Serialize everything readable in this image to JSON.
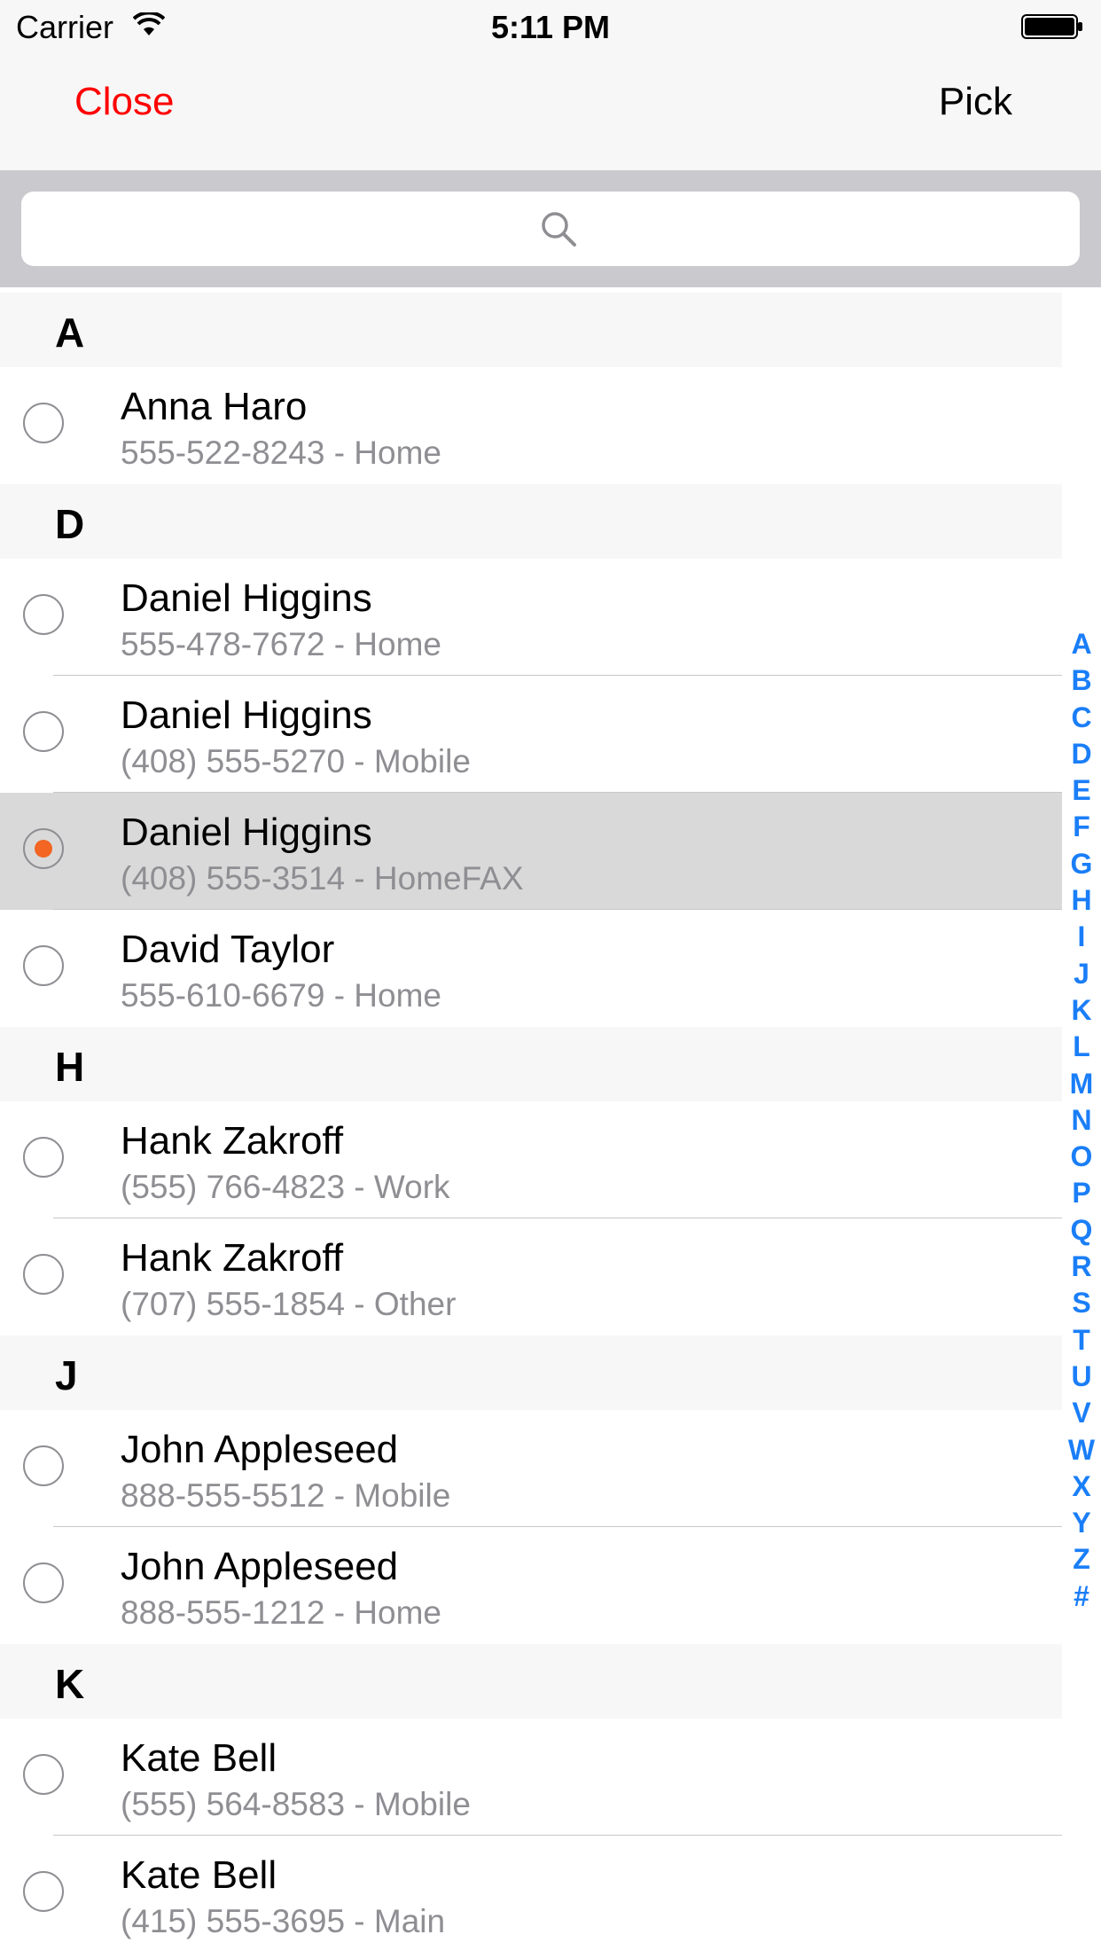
{
  "status_bar": {
    "carrier": "Carrier",
    "time": "5:11 PM"
  },
  "nav": {
    "close_label": "Close",
    "pick_label": "Pick"
  },
  "search": {
    "icon": "search-icon"
  },
  "colors": {
    "close": "#fe0000",
    "radio_selected": "#f26522",
    "index": "#1a7ef8",
    "selected_row": "#d9d9d9"
  },
  "sections": [
    {
      "letter": "A",
      "rows": [
        {
          "name": "Anna Haro",
          "detail": "555-522-8243 - Home",
          "selected": false
        }
      ]
    },
    {
      "letter": "D",
      "rows": [
        {
          "name": "Daniel Higgins",
          "detail": "555-478-7672 - Home",
          "selected": false
        },
        {
          "name": "Daniel Higgins",
          "detail": "(408) 555-5270 - Mobile",
          "selected": false
        },
        {
          "name": "Daniel Higgins",
          "detail": "(408) 555-3514 - HomeFAX",
          "selected": true
        },
        {
          "name": "David Taylor",
          "detail": "555-610-6679 - Home",
          "selected": false
        }
      ]
    },
    {
      "letter": "H",
      "rows": [
        {
          "name": "Hank Zakroff",
          "detail": "(555) 766-4823 - Work",
          "selected": false
        },
        {
          "name": "Hank Zakroff",
          "detail": "(707) 555-1854 - Other",
          "selected": false
        }
      ]
    },
    {
      "letter": "J",
      "rows": [
        {
          "name": "John Appleseed",
          "detail": "888-555-5512 - Mobile",
          "selected": false
        },
        {
          "name": "John Appleseed",
          "detail": "888-555-1212 - Home",
          "selected": false
        }
      ]
    },
    {
      "letter": "K",
      "rows": [
        {
          "name": "Kate Bell",
          "detail": "(555) 564-8583 - Mobile",
          "selected": false
        },
        {
          "name": "Kate Bell",
          "detail": "(415) 555-3695 - Main",
          "selected": false
        }
      ]
    }
  ],
  "index_letters": [
    "A",
    "B",
    "C",
    "D",
    "E",
    "F",
    "G",
    "H",
    "I",
    "J",
    "K",
    "L",
    "M",
    "N",
    "O",
    "P",
    "Q",
    "R",
    "S",
    "T",
    "U",
    "V",
    "W",
    "X",
    "Y",
    "Z",
    "#"
  ]
}
